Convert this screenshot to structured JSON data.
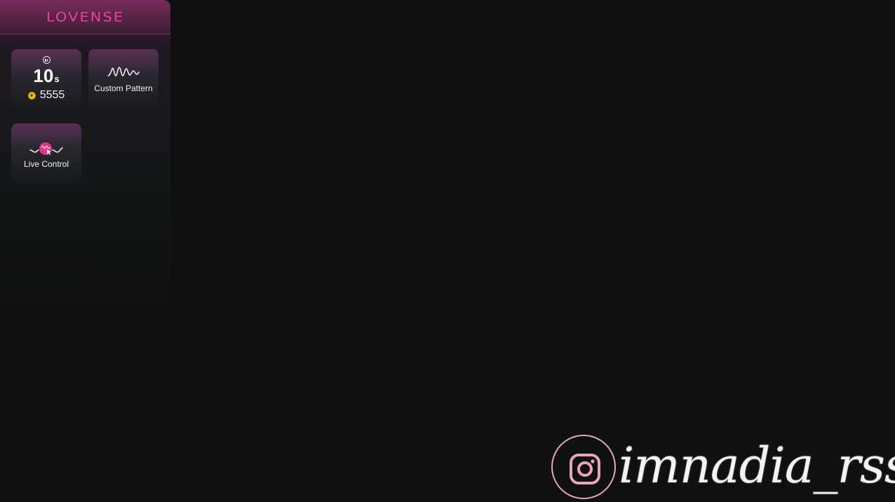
{
  "panel": {
    "brand": "LOVENSE",
    "timer_tile": {
      "icon": "pause-icon",
      "value": "10",
      "unit": "s",
      "coin_icon": "coin-icon",
      "tokens": "5555"
    },
    "pattern_tile": {
      "icon": "wave-icon",
      "label": "Custom Pattern"
    },
    "live_tile": {
      "icon": "live-control-icon",
      "label": "Live Control"
    }
  },
  "watermark": {
    "icon": "instagram-icon",
    "handle": "imnadia_rss"
  },
  "colors": {
    "brand": "#ec3f9c",
    "background": "#0f1110",
    "coin": "#e8c41a",
    "ring": "#e9a4be"
  }
}
